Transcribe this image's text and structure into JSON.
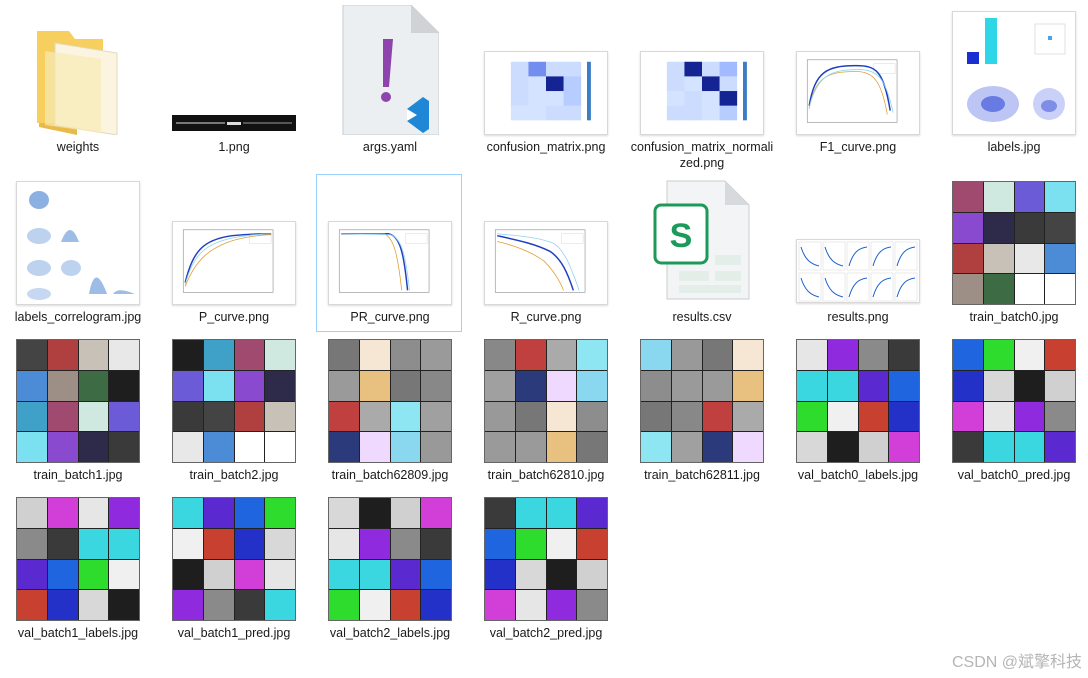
{
  "files": [
    {
      "name": "weights",
      "kind": "folder"
    },
    {
      "name": "1.png",
      "kind": "banner"
    },
    {
      "name": "args.yaml",
      "kind": "yaml"
    },
    {
      "name": "confusion_matrix.png",
      "kind": "matrix"
    },
    {
      "name": "confusion_matrix_normalized.png",
      "kind": "matrix2"
    },
    {
      "name": "F1_curve.png",
      "kind": "curve_f1"
    },
    {
      "name": "labels.jpg",
      "kind": "labels"
    },
    {
      "name": "labels_correlogram.jpg",
      "kind": "correlogram"
    },
    {
      "name": "P_curve.png",
      "kind": "curve_p"
    },
    {
      "name": "PR_curve.png",
      "kind": "curve_pr"
    },
    {
      "name": "R_curve.png",
      "kind": "curve_r"
    },
    {
      "name": "results.csv",
      "kind": "csv"
    },
    {
      "name": "results.png",
      "kind": "results"
    },
    {
      "name": "train_batch0.jpg",
      "kind": "mosaic"
    },
    {
      "name": "train_batch1.jpg",
      "kind": "mosaic"
    },
    {
      "name": "train_batch2.jpg",
      "kind": "mosaic"
    },
    {
      "name": "train_batch62809.jpg",
      "kind": "mosaic_gray"
    },
    {
      "name": "train_batch62810.jpg",
      "kind": "mosaic_gray"
    },
    {
      "name": "train_batch62811.jpg",
      "kind": "mosaic_gray"
    },
    {
      "name": "val_batch0_labels.jpg",
      "kind": "mosaic_val"
    },
    {
      "name": "val_batch0_pred.jpg",
      "kind": "mosaic_val"
    },
    {
      "name": "val_batch1_labels.jpg",
      "kind": "mosaic_val"
    },
    {
      "name": "val_batch1_pred.jpg",
      "kind": "mosaic_val"
    },
    {
      "name": "val_batch2_labels.jpg",
      "kind": "mosaic_val"
    },
    {
      "name": "val_batch2_pred.jpg",
      "kind": "mosaic_val"
    }
  ],
  "selected": "PR_curve.png",
  "watermark": "CSDN @斌擎科技",
  "colors": {
    "selection_border": "#99d1ff",
    "folder": "#f6cf5e",
    "yaml_accent": "#8e44ad",
    "vscode_blue": "#1f87d6",
    "csv_green": "#1b9a59"
  }
}
